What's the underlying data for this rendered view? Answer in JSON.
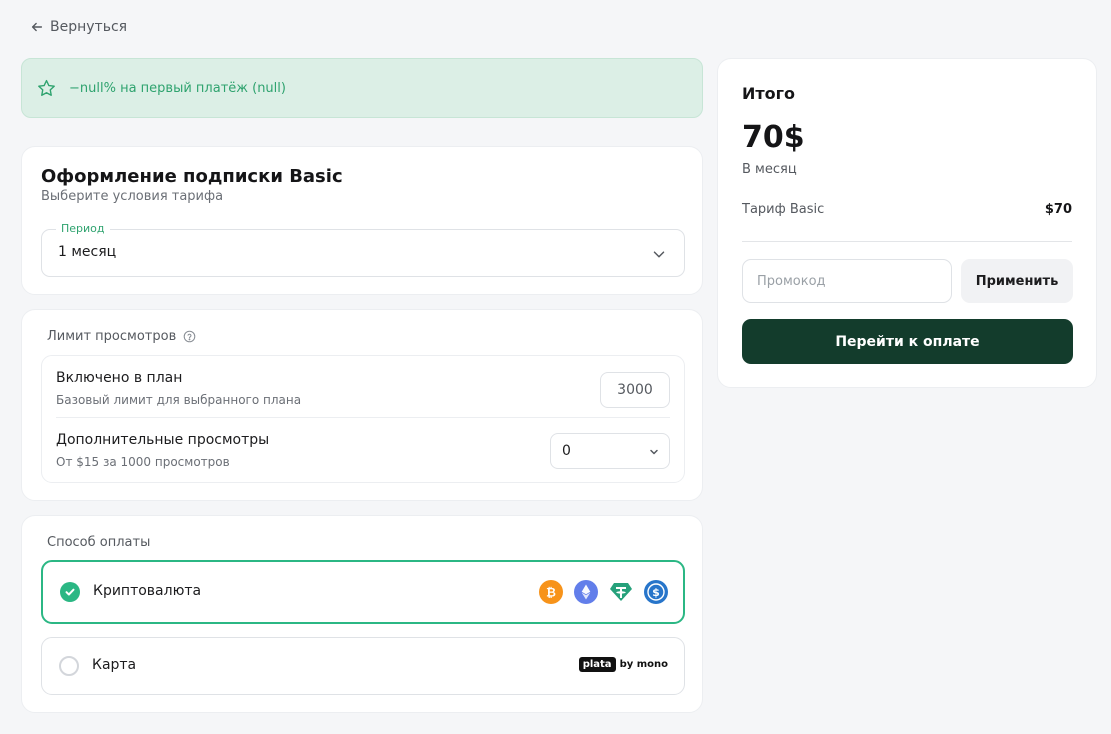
{
  "nav": {
    "back_label": "Вернуться"
  },
  "promo_banner": {
    "text": "−null% на первый платёж (null)"
  },
  "subscription": {
    "title": "Оформление подписки Basic",
    "subtitle": "Выберите условия тарифа",
    "period_label": "Период",
    "period_value": "1 месяц"
  },
  "limits": {
    "title": "Лимит просмотров",
    "included_label": "Включено в план",
    "included_desc": "Базовый лимит для выбранного плана",
    "included_value": "3000",
    "extra_label": "Дополнительные просмотры",
    "extra_desc": "От $15 за 1000 просмотров",
    "extra_value": "0"
  },
  "payment": {
    "title": "Способ оплаты",
    "options": [
      {
        "name": "Криптовалюта",
        "selected": true,
        "icons": [
          "bitcoin-icon",
          "ethereum-icon",
          "tether-icon",
          "usdc-icon"
        ]
      },
      {
        "name": "Карта",
        "selected": false,
        "brand_box": "plata",
        "brand_suffix": "by mono"
      }
    ]
  },
  "summary": {
    "title": "Итого",
    "price": "70$",
    "period": "В месяц",
    "line_label": "Тариф Basic",
    "line_value": "$70",
    "promo_placeholder": "Промокод",
    "apply_label": "Применить",
    "pay_label": "Перейти к оплате"
  },
  "colors": {
    "accent": "#2bb784",
    "primary_button": "#133c2c",
    "banner_bg": "#dcefe6",
    "bitcoin": "#f7931a",
    "ethereum": "#627eea",
    "tether": "#26a17b",
    "usdc": "#2775ca"
  }
}
